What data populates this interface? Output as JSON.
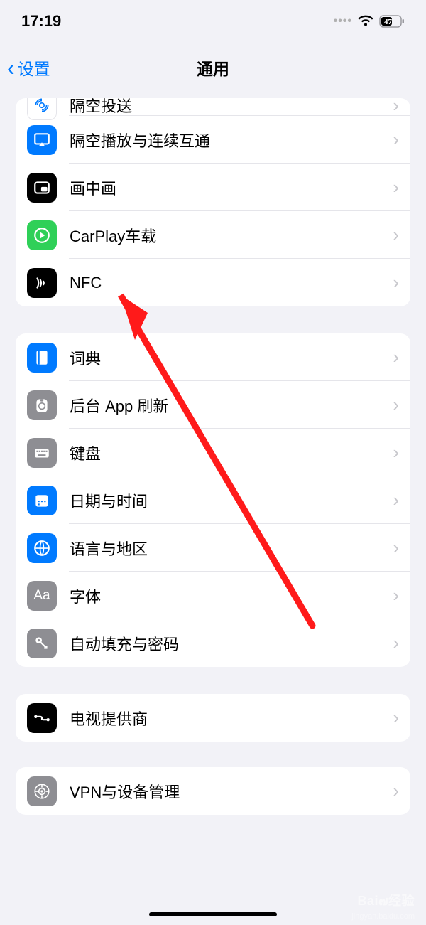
{
  "status": {
    "time": "17:19",
    "battery_percent": "47"
  },
  "nav": {
    "back_label": "设置",
    "title": "通用"
  },
  "sections": [
    {
      "rows": [
        {
          "icon": "airdrop-icon",
          "icon_bg": "icon-white",
          "label": "隔空投送",
          "partial": true
        },
        {
          "icon": "airplay-icon",
          "icon_bg": "icon-blue",
          "label": "隔空播放与连续互通"
        },
        {
          "icon": "pip-icon",
          "icon_bg": "icon-black",
          "label": "画中画"
        },
        {
          "icon": "carplay-icon",
          "icon_bg": "icon-green",
          "label": "CarPlay车载"
        },
        {
          "icon": "nfc-icon",
          "icon_bg": "icon-black",
          "label": "NFC"
        }
      ]
    },
    {
      "rows": [
        {
          "icon": "dictionary-icon",
          "icon_bg": "icon-blue",
          "label": "词典"
        },
        {
          "icon": "bg-refresh-icon",
          "icon_bg": "icon-grey",
          "label": "后台 App 刷新"
        },
        {
          "icon": "keyboard-icon",
          "icon_bg": "icon-grey",
          "label": "键盘"
        },
        {
          "icon": "date-time-icon",
          "icon_bg": "icon-blue",
          "label": "日期与时间"
        },
        {
          "icon": "language-icon",
          "icon_bg": "icon-blue",
          "label": "语言与地区"
        },
        {
          "icon": "fonts-icon",
          "icon_bg": "icon-grey",
          "label": "字体"
        },
        {
          "icon": "autofill-icon",
          "icon_bg": "icon-grey",
          "label": "自动填充与密码"
        }
      ]
    },
    {
      "rows": [
        {
          "icon": "tv-provider-icon",
          "icon_bg": "icon-black",
          "label": "电视提供商"
        }
      ]
    },
    {
      "rows": [
        {
          "icon": "vpn-icon",
          "icon_bg": "icon-grey",
          "label": "VPN与设备管理"
        }
      ]
    }
  ],
  "watermark": {
    "brand": "Bai๗经验",
    "url": "jingyan.baidu.com"
  }
}
